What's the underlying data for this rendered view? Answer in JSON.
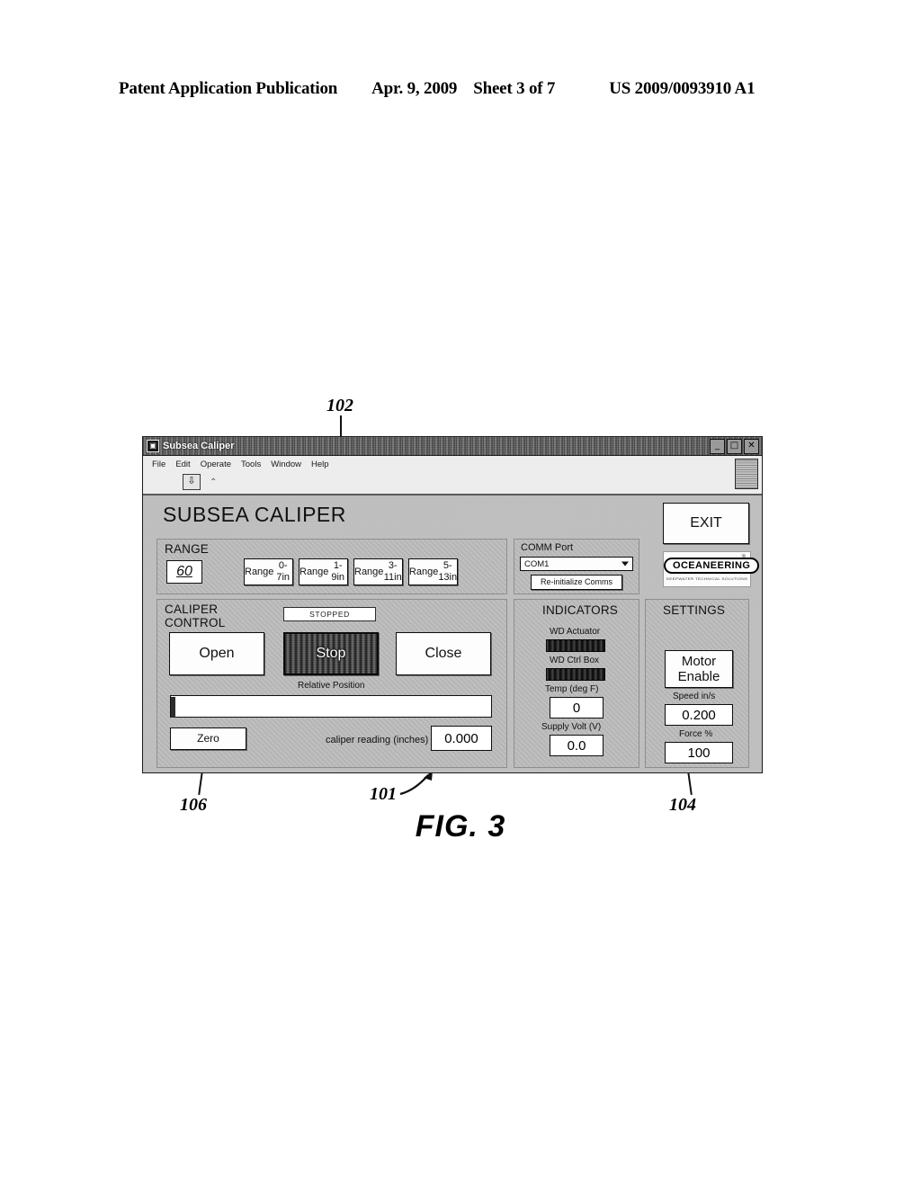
{
  "page_header": {
    "publication": "Patent Application Publication",
    "date": "Apr. 9, 2009",
    "sheet": "Sheet 3 of 7",
    "patent_number": "US 2009/0093910 A1"
  },
  "figure": {
    "caption": "FIG. 3",
    "callouts": [
      {
        "id": "102",
        "label": "102"
      },
      {
        "id": "101",
        "label": "101"
      },
      {
        "id": "106",
        "label": "106"
      },
      {
        "id": "104",
        "label": "104"
      }
    ]
  },
  "window": {
    "title": "Subsea Caliper",
    "icon": "labview-window-icon",
    "controls": {
      "minimize": "_",
      "maximize": "□",
      "close": "✕"
    },
    "menus": [
      "File",
      "Edit",
      "Operate",
      "Tools",
      "Window",
      "Help"
    ],
    "run_button": "⇩",
    "toolbar_mark": "⌃"
  },
  "app": {
    "title": "SUBSEA CALIPER",
    "exit_button": "EXIT",
    "logo": {
      "name": "OCEANEERING",
      "tagline": "DEEPWATER TECHNICAL SOLUTIONS",
      "registered_mark": "®"
    }
  },
  "range_panel": {
    "title": "RANGE",
    "value": "60",
    "buttons": [
      {
        "line1": "Range",
        "line2": "0-7in"
      },
      {
        "line1": "Range",
        "line2": "1-9in"
      },
      {
        "line1": "Range",
        "line2": "3-11in"
      },
      {
        "line1": "Range",
        "line2": "5-13in"
      }
    ]
  },
  "comm_panel": {
    "title": "COMM Port",
    "selected_port": "COM1",
    "reinit_button": "Re-initialize Comms"
  },
  "caliper_control": {
    "title": "CALIPER\nCONTROL",
    "status": "STOPPED",
    "open_button": "Open",
    "stop_button": "Stop",
    "close_button": "Close",
    "relative_position_label": "Relative Position",
    "zero_button": "Zero",
    "reading_label": "caliper reading (inches)",
    "reading_value": "0.000"
  },
  "indicators": {
    "title": "INDICATORS",
    "items": [
      {
        "label": "WD Actuator",
        "type": "led",
        "state": "off"
      },
      {
        "label": "WD Ctrl Box",
        "type": "led",
        "state": "off"
      },
      {
        "label": "Temp (deg F)",
        "type": "value",
        "value": "0"
      },
      {
        "label": "Supply Volt (V)",
        "type": "value",
        "value": "0.0"
      }
    ]
  },
  "settings": {
    "title": "SETTINGS",
    "motor_enable_button": "Motor\nEnable",
    "speed_label": "Speed in/s",
    "speed_value": "0.200",
    "force_label": "Force %",
    "force_value": "100"
  }
}
